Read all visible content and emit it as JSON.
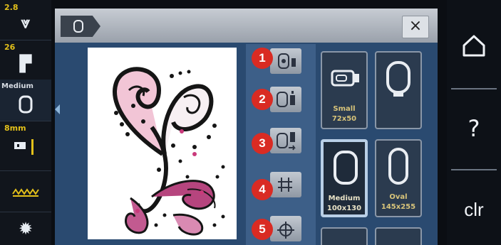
{
  "leftbar": {
    "items": [
      {
        "value": "2.8",
        "icon": "stitch-length-icon"
      },
      {
        "value": "26",
        "icon": "presser-foot-icon"
      },
      {
        "value": "Medium",
        "icon": "hoop-icon"
      },
      {
        "value": "8mm",
        "icon": "needle-plate-icon"
      },
      {
        "value": "",
        "icon": "feed-dog-icon"
      },
      {
        "value": "",
        "icon": "settings-gear-icon"
      }
    ]
  },
  "header": {
    "close_label": "×"
  },
  "functions": [
    {
      "badge": "1",
      "icon": "hoop-auto-select-icon"
    },
    {
      "badge": "2",
      "icon": "hoop-info-icon"
    },
    {
      "badge": "3",
      "icon": "hoop-move-icon"
    },
    {
      "badge": "4",
      "icon": "grid-icon"
    },
    {
      "badge": "5",
      "icon": "center-mark-icon"
    }
  ],
  "hoops": [
    {
      "name": "Small",
      "size": "72x50"
    },
    {
      "name": "Medium",
      "size": "100x130"
    },
    {
      "name": "Oval",
      "size": "145x255"
    }
  ],
  "rightbar": {
    "home_icon": "home-icon",
    "help_label": "?",
    "clear_label": "clr"
  },
  "colors": {
    "accent_badge": "#d92b23",
    "panel": "#2a4a70",
    "value_text": "#e3c01a"
  }
}
